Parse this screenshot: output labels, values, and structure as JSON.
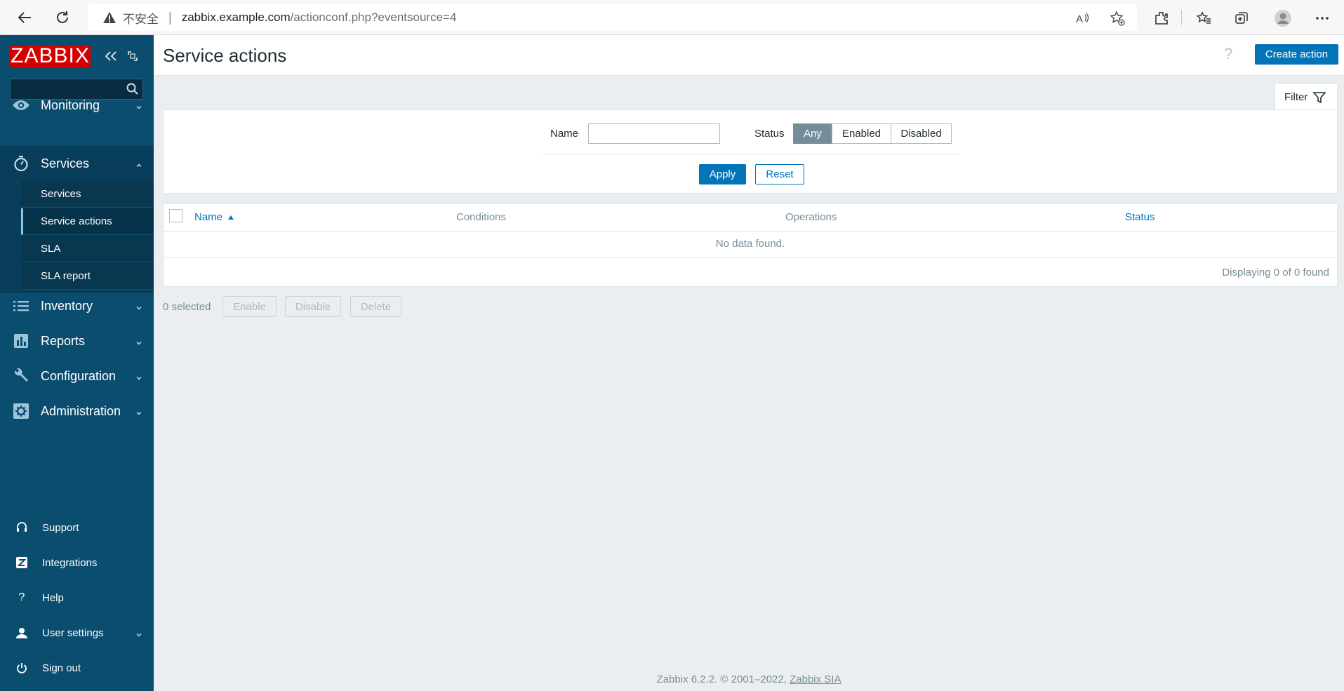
{
  "browser": {
    "insecure_label": "不安全",
    "url_host": "zabbix.example.com",
    "url_path": "/actionconf.php?eventsource=4"
  },
  "sidebar": {
    "logo_text": "ZABBIX",
    "search_placeholder": "",
    "menu": [
      {
        "label": "Monitoring",
        "icon": "eye-icon",
        "expanded": false
      },
      {
        "label": "Services",
        "icon": "stopwatch-icon",
        "expanded": true
      },
      {
        "label": "Inventory",
        "icon": "list-icon",
        "expanded": false
      },
      {
        "label": "Reports",
        "icon": "bar-chart-icon",
        "expanded": false
      },
      {
        "label": "Configuration",
        "icon": "wrench-icon",
        "expanded": false
      },
      {
        "label": "Administration",
        "icon": "gear-icon",
        "expanded": false
      }
    ],
    "submenu": [
      {
        "label": "Services",
        "active": false
      },
      {
        "label": "Service actions",
        "active": true
      },
      {
        "label": "SLA",
        "active": false
      },
      {
        "label": "SLA report",
        "active": false
      }
    ],
    "bottom": [
      {
        "label": "Support",
        "icon": "headset-icon"
      },
      {
        "label": "Integrations",
        "icon": "z-icon"
      },
      {
        "label": "Help",
        "icon": "question-icon"
      },
      {
        "label": "User settings",
        "icon": "user-icon"
      },
      {
        "label": "Sign out",
        "icon": "power-icon"
      }
    ]
  },
  "header": {
    "title": "Service actions",
    "create_button": "Create action",
    "help": "?"
  },
  "filter": {
    "tab_label": "Filter",
    "name_label": "Name",
    "name_value": "",
    "status_label": "Status",
    "status_options": [
      "Any",
      "Enabled",
      "Disabled"
    ],
    "status_selected": "Any",
    "apply": "Apply",
    "reset": "Reset"
  },
  "table": {
    "columns": [
      "Name",
      "Conditions",
      "Operations",
      "Status"
    ],
    "sort_column": "Name",
    "empty_text": "No data found.",
    "displaying": "Displaying 0 of 0 found"
  },
  "actions_bar": {
    "selected_count": "0 selected",
    "enable": "Enable",
    "disable": "Disable",
    "delete": "Delete"
  },
  "footer": {
    "text": "Zabbix 6.2.2. © 2001–2022, ",
    "link": "Zabbix SIA"
  },
  "colors": {
    "sidebar_bg": "#0b4d6f",
    "accent": "#0275b8",
    "logo_red": "#d40000",
    "page_bg": "#ebeef0"
  }
}
